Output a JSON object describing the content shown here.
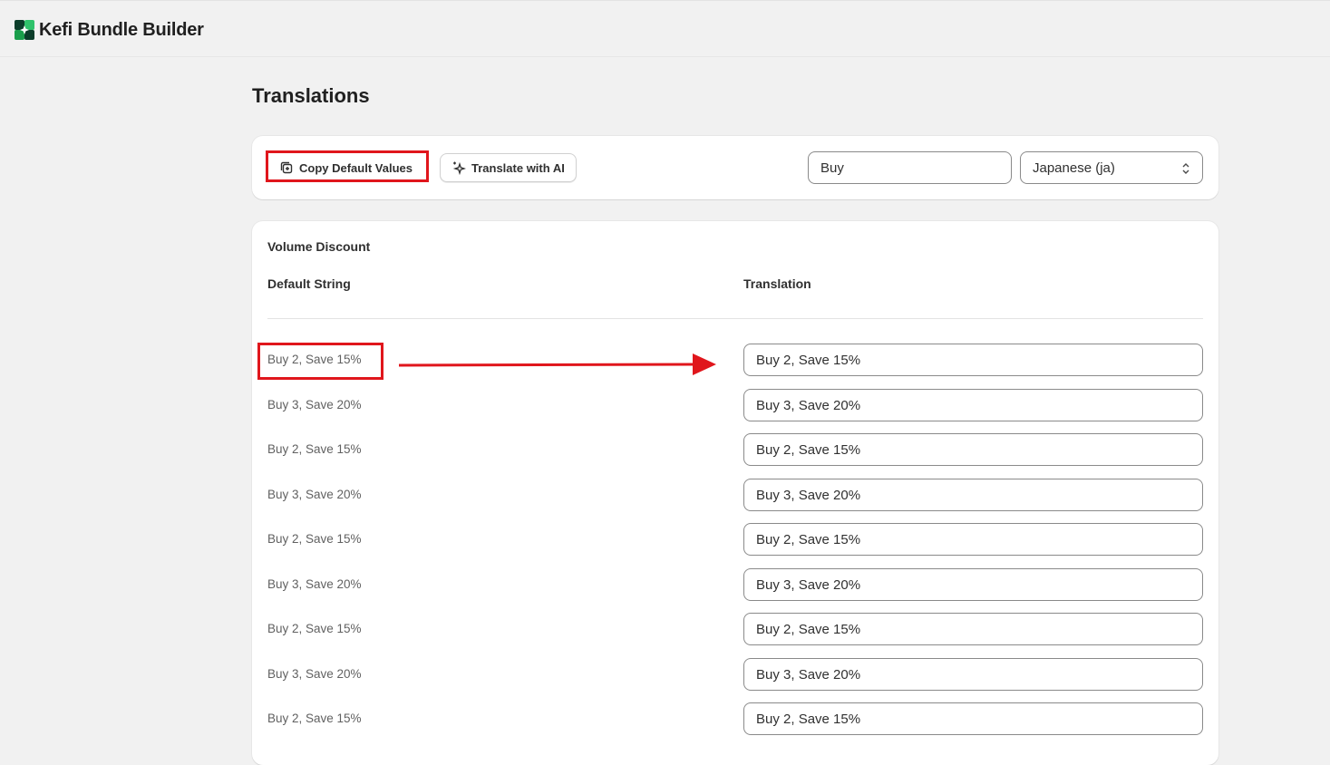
{
  "app": {
    "name": "Kefi Bundle Builder",
    "logo_icon": "kefi-logo-icon"
  },
  "page": {
    "title": "Translations"
  },
  "toolbar": {
    "copy_label": "Copy Default Values",
    "copy_icon": "copy-icon",
    "ai_label": "Translate with AI",
    "ai_icon": "sparkle-icon",
    "search_value": "Buy",
    "language_value": "Japanese (ja)",
    "language_icon": "select-chevron-icon"
  },
  "section": {
    "title": "Volume Discount",
    "col_default": "Default String",
    "col_translation": "Translation"
  },
  "rows": [
    {
      "default": "Buy 2, Save 15%",
      "translation": "Buy 2, Save 15%"
    },
    {
      "default": "Buy 3, Save 20%",
      "translation": "Buy 3, Save 20%"
    },
    {
      "default": "Buy 2, Save 15%",
      "translation": "Buy 2, Save 15%"
    },
    {
      "default": "Buy 3, Save 20%",
      "translation": "Buy 3, Save 20%"
    },
    {
      "default": "Buy 2, Save 15%",
      "translation": "Buy 2, Save 15%"
    },
    {
      "default": "Buy 3, Save 20%",
      "translation": "Buy 3, Save 20%"
    },
    {
      "default": "Buy 2, Save 15%",
      "translation": "Buy 2, Save 15%"
    },
    {
      "default": "Buy 3, Save 20%",
      "translation": "Buy 3, Save 20%"
    },
    {
      "default": "Buy 2, Save 15%",
      "translation": "Buy 2, Save 15%"
    }
  ],
  "colors": {
    "annotation": "#e0161c",
    "logo_green": "#1a9e4b",
    "logo_dark": "#0b3d2a"
  }
}
